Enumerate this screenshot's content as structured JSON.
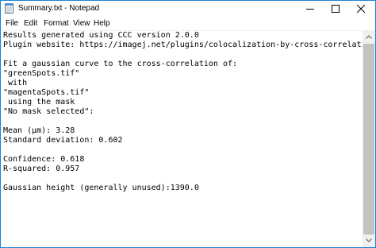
{
  "window": {
    "title": "Summary.txt - Notepad",
    "app_icon": "notepad-icon",
    "buttons": {
      "minimize": "minimize-icon",
      "maximize": "maximize-icon",
      "close": "close-icon"
    }
  },
  "menu": {
    "items": [
      {
        "label": "File"
      },
      {
        "label": "Edit"
      },
      {
        "label": "Format"
      },
      {
        "label": "View"
      },
      {
        "label": "Help"
      }
    ]
  },
  "document": {
    "lines": [
      "Results generated using CCC version 2.0.0",
      "Plugin website: https://imagej.net/plugins/colocalization-by-cross-correlation",
      "",
      "Fit a gaussian curve to the cross-correlation of:",
      "\"greenSpots.tif\"",
      " with",
      "\"magentaSpots.tif\"",
      " using the mask",
      "\"No mask selected\":",
      "",
      "Mean (µm): 3.28",
      "Standard deviation: 0.602",
      "",
      "Confidence: 0.618",
      "R-squared: 0.957",
      "",
      "Gaussian height (generally unused):1390.0"
    ]
  },
  "scrollbar": {
    "up_icon": "scroll-up-arrow-icon",
    "down_icon": "scroll-down-arrow-icon",
    "thumb_fraction": 1.0
  },
  "colors": {
    "border": "#1883d7",
    "scrollbar_track": "#f0f0f0",
    "scrollbar_thumb": "#c2c2c2",
    "text": "#000000"
  }
}
